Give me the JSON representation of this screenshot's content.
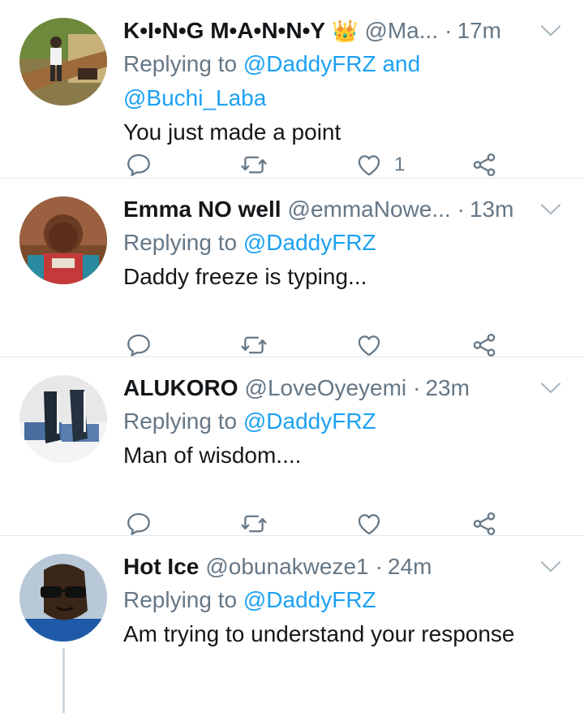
{
  "tweets": [
    {
      "name": "K•I•N•G M•A•N•N•Y",
      "crown": "👑",
      "handle": "@Ma...",
      "time": "17m",
      "replying_prefix": "Replying to ",
      "replying_line1_mentions": "@DaddyFRZ",
      "replying_and": " and",
      "replying_line2": "@Buchi_Laba",
      "text": "You just made a point",
      "like_count": "1"
    },
    {
      "name": "Emma NO well",
      "handle": "@emmaNowe...",
      "time": "13m",
      "replying_prefix": "Replying to ",
      "replying_mention": "@DaddyFRZ",
      "text": "Daddy freeze is typing..."
    },
    {
      "name": "ALUKORO",
      "handle": "@LoveOyeyemi",
      "time": "23m",
      "replying_prefix": "Replying to ",
      "replying_mention": "@DaddyFRZ",
      "text": "Man of wisdom...."
    },
    {
      "name": "Hot Ice",
      "handle": "@obunakweze1",
      "time": "24m",
      "replying_prefix": "Replying to ",
      "replying_mention": "@DaddyFRZ",
      "text": "Am trying to understand your response"
    }
  ],
  "separator": "·",
  "icons": {
    "reply": "reply-icon",
    "retweet": "retweet-icon",
    "like": "heart-icon",
    "share": "share-icon",
    "menu": "chevron-down-icon"
  },
  "colors": {
    "mention": "#1da1f2",
    "secondary_text": "#657786",
    "primary_text": "#14171a",
    "divider": "#e1e8ed"
  }
}
